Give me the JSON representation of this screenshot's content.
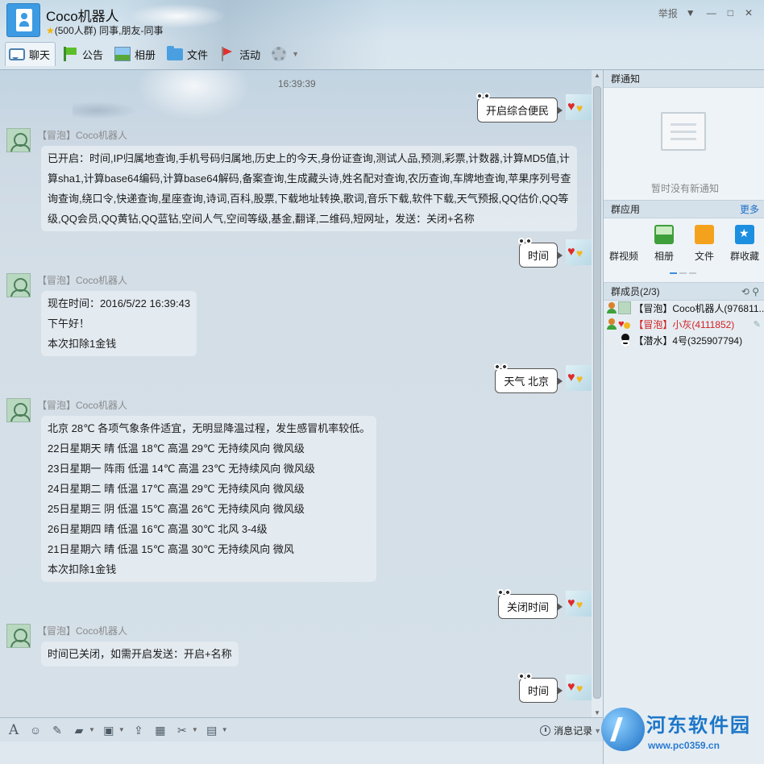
{
  "header": {
    "title": "Coco机器人",
    "subtitle_count": "(500人群)",
    "subtitle_tags": "同事,朋友-同事",
    "report": "举报"
  },
  "toolbar": {
    "chat": "聊天",
    "notice": "公告",
    "album": "相册",
    "files": "文件",
    "activity": "活动"
  },
  "chat": {
    "timestamp": "16:39:39",
    "sender": "【冒泡】Coco机器人",
    "out1": "开启综合便民",
    "in1": [
      "已开启：时间,IP归属地查询,手机号码归属地,历史上的今天,身份证查询,测试人品,预测,彩票,计数器,计算MD5值,计",
      "算sha1,计算base64编码,计算base64解码,备案查询,生成藏头诗,姓名配对查询,农历查询,车牌地查询,苹果序列号查",
      "询查询,绕口令,快递查询,星座查询,诗词,百科,股票,下载地址转换,歌词,音乐下载,软件下载,天气预报,QQ估价,QQ等",
      "级,QQ会员,QQ黄钻,QQ蓝钻,空间人气,空间等级,基金,翻译,二维码,短网址，发送：关闭+名称"
    ],
    "out2": "时间",
    "in2": [
      "现在时间：2016/5/22 16:39:43",
      "下午好！",
      "本次扣除1金钱"
    ],
    "out3": "天气 北京",
    "in3": [
      "北京 28℃ 各项气象条件适宜，无明显降温过程，发生感冒机率较低。",
      "22日星期天 晴 低温 18℃ 高温 29℃ 无持续风向 微风级",
      "23日星期一 阵雨 低温 14℃ 高温 23℃ 无持续风向 微风级",
      "24日星期二 晴 低温 17℃ 高温 29℃ 无持续风向 微风级",
      "25日星期三 阴 低温 15℃ 高温 26℃ 无持续风向 微风级",
      "26日星期四 晴 低温 16℃ 高温 30℃ 北风 3-4级",
      "21日星期六 晴 低温 15℃ 高温 30℃ 无持续风向 微风",
      "本次扣除1金钱"
    ],
    "out4": "关闭时间",
    "in4": [
      "时间已关闭，如需开启发送：开启+名称"
    ],
    "out5": "时间"
  },
  "input_bar": {
    "history": "消息记录"
  },
  "right_panel": {
    "notice_title": "群通知",
    "notice_empty": "暂时没有新通知",
    "apps_title": "群应用",
    "apps_more": "更多",
    "apps": [
      "群视频",
      "相册",
      "文件",
      "群收藏"
    ],
    "members_title": "群成员(2/3)",
    "members": [
      {
        "tag": "【冒泡】",
        "name": "Coco机器人(976811..."
      },
      {
        "tag": "【冒泡】",
        "name": "小灰(4111852)"
      },
      {
        "tag": "【潜水】",
        "name": "4号(325907794)"
      }
    ]
  },
  "watermark": {
    "title": "河东软件园",
    "url": "www.pc0359.cn"
  }
}
